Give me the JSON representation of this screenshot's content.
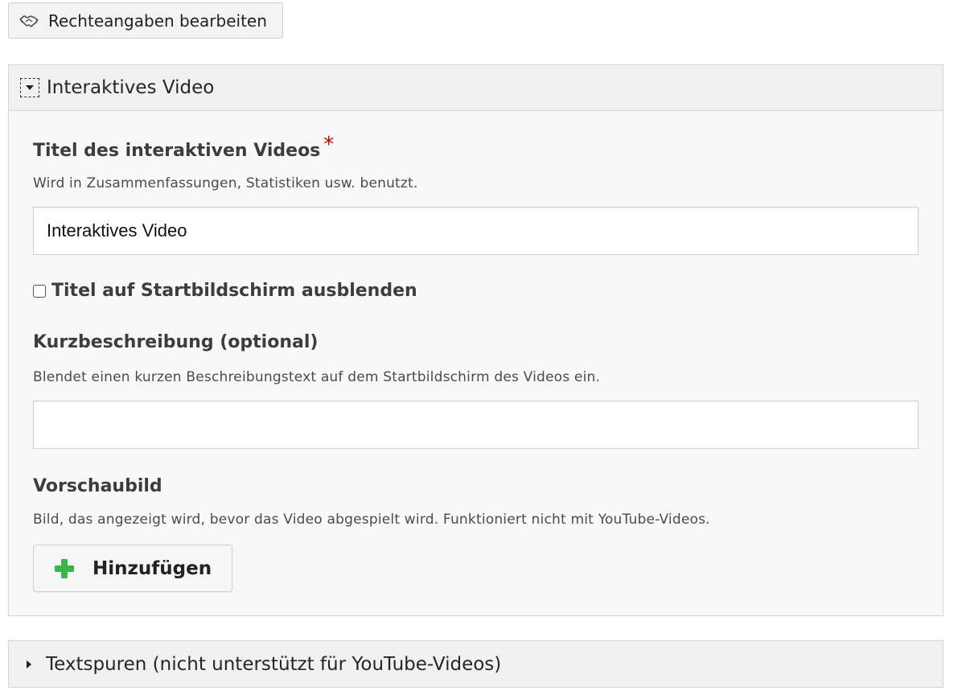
{
  "copyright_button": {
    "label": "Rechteangaben bearbeiten",
    "icon": "handshake-icon"
  },
  "main_group": {
    "title": "Interaktives Video",
    "expanded": true,
    "title_field": {
      "label": "Titel des interaktiven Videos",
      "required_mark": "*",
      "description": "Wird in Zusammenfassungen, Statistiken usw. benutzt.",
      "value": "Interaktives Video"
    },
    "hide_title_checkbox": {
      "label": "Titel auf Startbildschirm ausblenden",
      "checked": false
    },
    "short_description": {
      "label": "Kurzbeschreibung (optional)",
      "description": "Blendet einen kurzen Beschreibungstext auf dem Startbildschirm des Videos ein.",
      "value": ""
    },
    "poster": {
      "label": "Vorschaubild",
      "description": "Bild, das angezeigt wird, bevor das Video abgespielt wird. Funktioniert nicht mit YouTube-Videos.",
      "add_button_label": "Hinzufügen",
      "add_icon_color": "#3ab54a"
    }
  },
  "tracks_group": {
    "title": "Textspuren (nicht unterstützt für YouTube-Videos)",
    "expanded": false
  },
  "colors": {
    "required": "#d10000",
    "accent_green": "#3ab54a"
  }
}
